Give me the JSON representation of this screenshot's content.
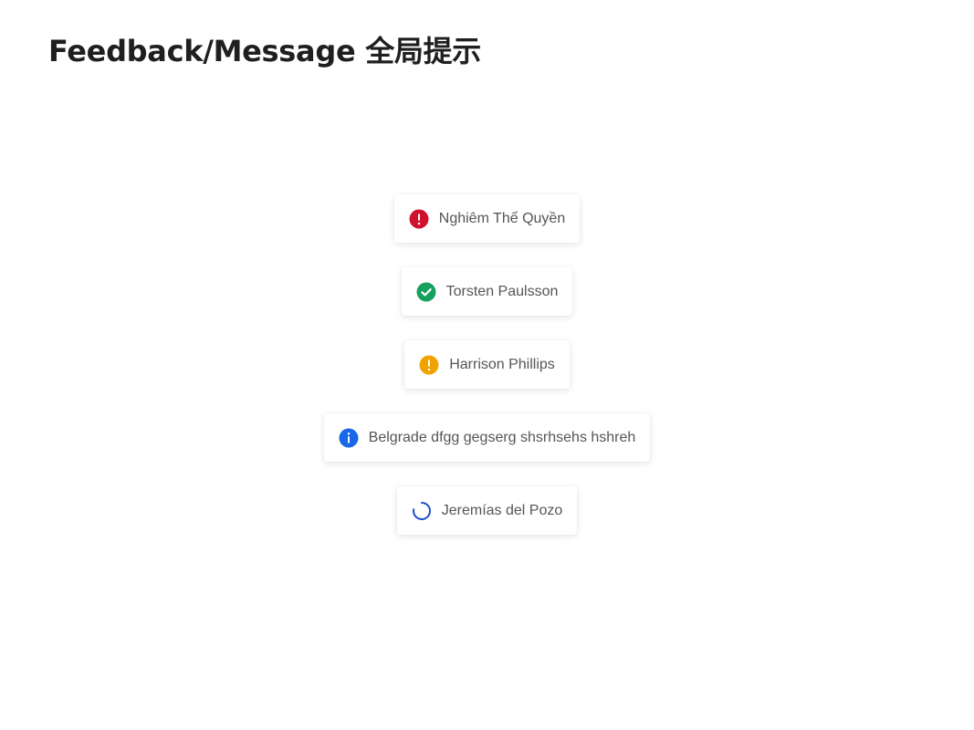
{
  "header": {
    "title": "Feedback/Message 全局提示"
  },
  "colors": {
    "error": "#d0112b",
    "success": "#17a05d",
    "warning": "#f0a300",
    "info": "#1767e6",
    "loading": "#1f4fc8",
    "text": "#555555",
    "title": "#1f1f1f"
  },
  "messages": [
    {
      "type": "error",
      "icon": "error-icon",
      "text": "Nghiêm Thế Quyền"
    },
    {
      "type": "success",
      "icon": "success-check-icon",
      "text": "Torsten Paulsson"
    },
    {
      "type": "warning",
      "icon": "warning-icon",
      "text": "Harrison Phillips"
    },
    {
      "type": "info",
      "icon": "info-icon",
      "text": "Belgrade dfgg gegserg shsrhsehs hshreh"
    },
    {
      "type": "loading",
      "icon": "loading-spinner-icon",
      "text": "Jeremías del Pozo"
    }
  ]
}
